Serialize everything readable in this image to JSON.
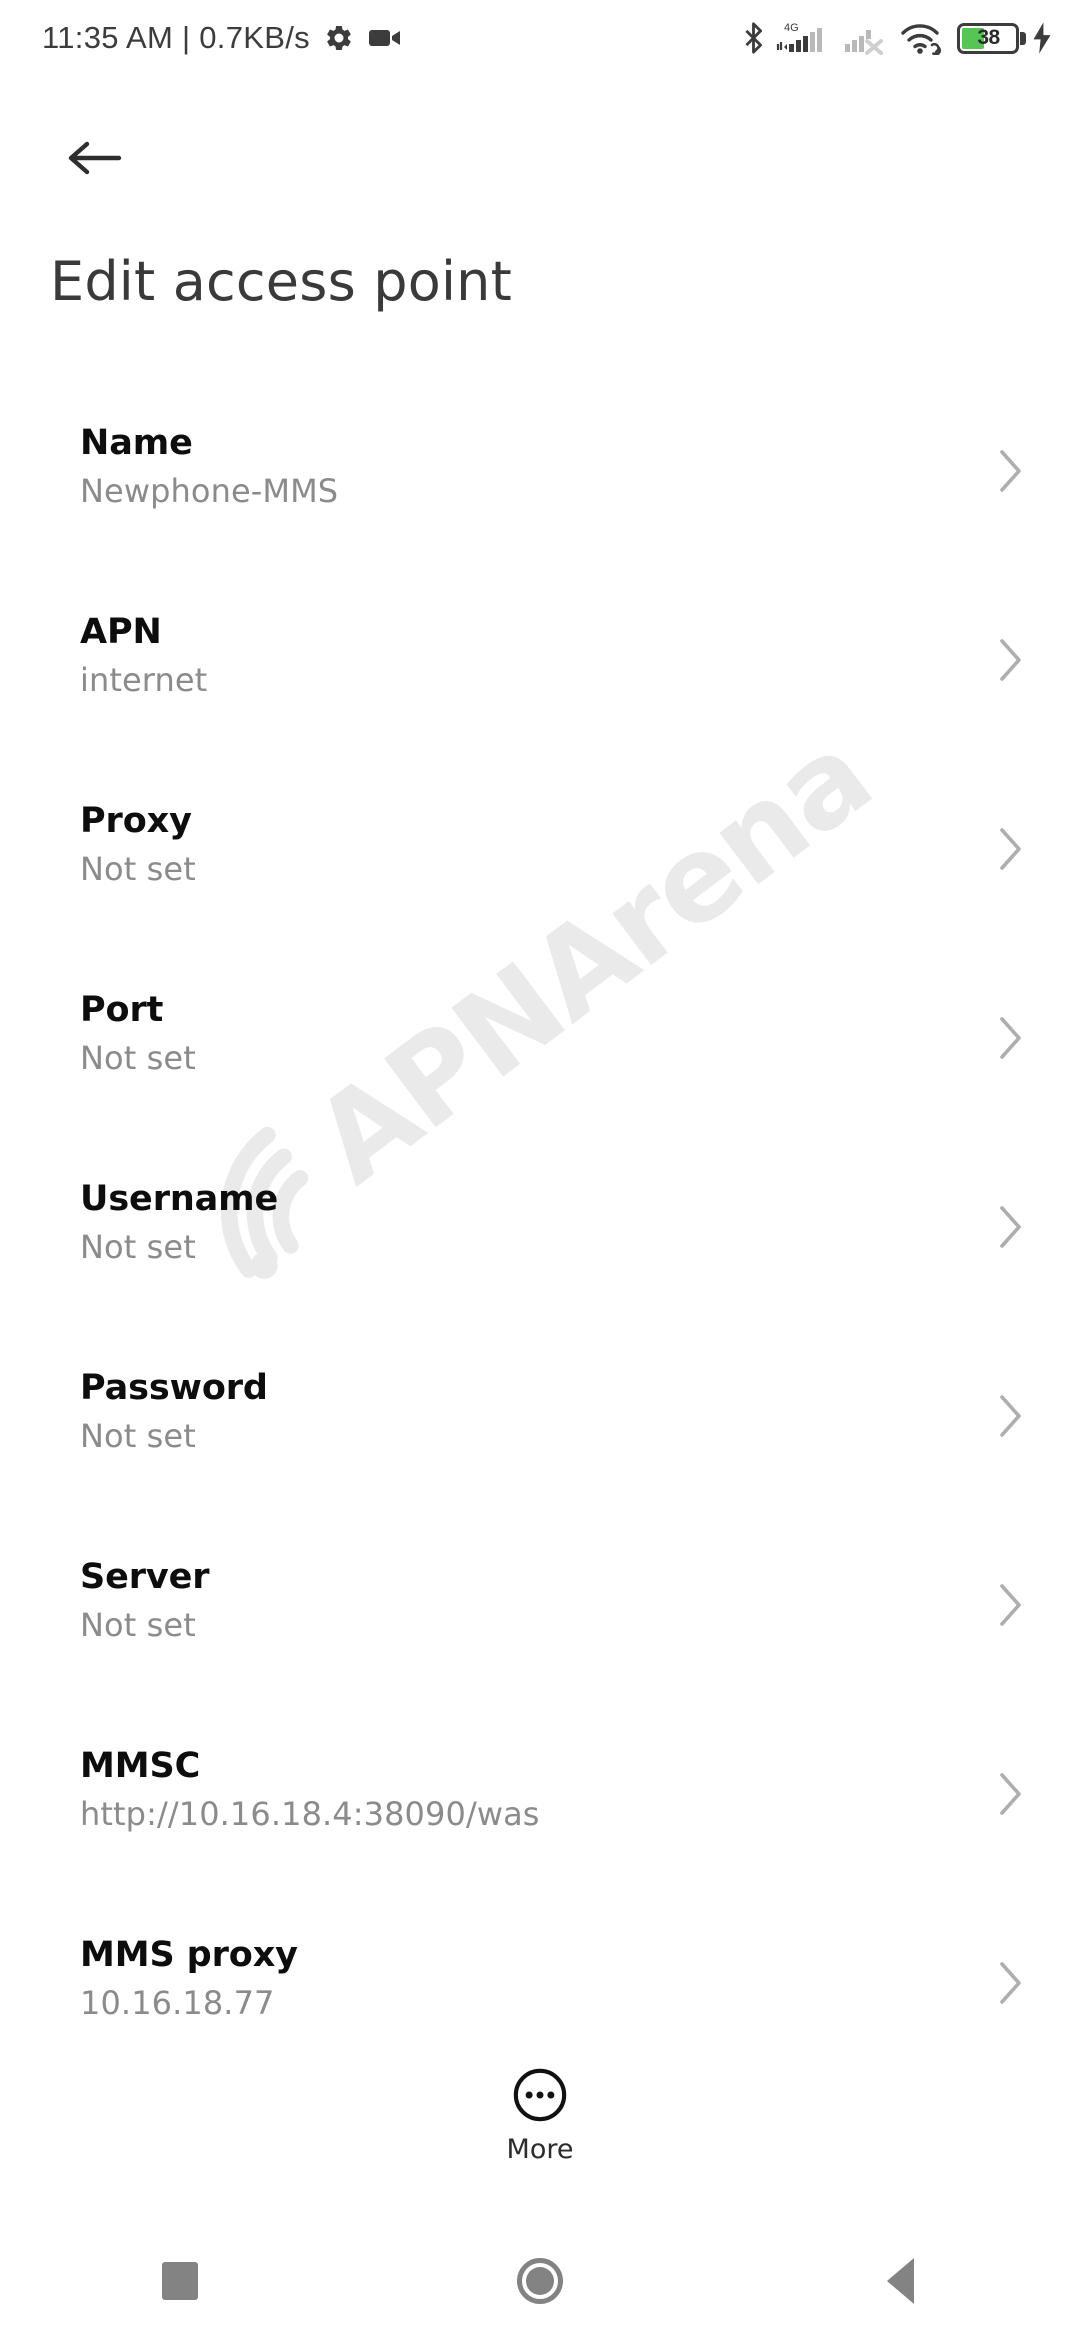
{
  "statusbar": {
    "clock": "11:35 AM | 0.7KB/s",
    "icons_left": [
      "gear-icon",
      "camcorder-icon"
    ],
    "icons_right": [
      "bluetooth-icon",
      "signal-4g-icon",
      "signal-sim2-no-service-icon",
      "wifi-link-icon",
      "battery-icon",
      "charging-bolt-icon"
    ],
    "network_label": "4G",
    "battery_level": "38",
    "battery_color": "#53c653"
  },
  "appbar": {
    "back_icon": "arrow-back-icon",
    "title": "Edit access point"
  },
  "watermark": {
    "text": "APNArena",
    "color": "#eaeaea"
  },
  "list": {
    "chevron_icon": "chevron-right-icon",
    "rows": [
      {
        "title": "Name",
        "value": "Newphone-MMS"
      },
      {
        "title": "APN",
        "value": "internet"
      },
      {
        "title": "Proxy",
        "value": "Not set"
      },
      {
        "title": "Port",
        "value": "Not set"
      },
      {
        "title": "Username",
        "value": "Not set"
      },
      {
        "title": "Password",
        "value": "Not set"
      },
      {
        "title": "Server",
        "value": "Not set"
      },
      {
        "title": "MMSC",
        "value": "http://10.16.18.4:38090/was"
      },
      {
        "title": "MMS proxy",
        "value": "10.16.18.77"
      }
    ]
  },
  "more": {
    "icon": "more-circle-icon",
    "label": "More"
  },
  "navbar": {
    "recents_label": "recents",
    "home_label": "home",
    "back_label": "back"
  }
}
